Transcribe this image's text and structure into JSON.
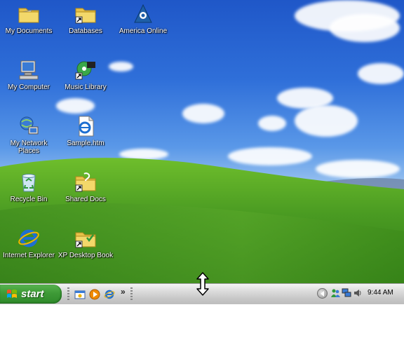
{
  "desktop": {
    "icons": [
      {
        "label": "My Documents"
      },
      {
        "label": "Databases"
      },
      {
        "label": "America Online"
      },
      {
        "label": "My Computer"
      },
      {
        "label": "Music Library"
      },
      {
        "label": "My Network Places"
      },
      {
        "label": "Sample.htm"
      },
      {
        "label": "Recycle Bin"
      },
      {
        "label": "Shared Docs"
      },
      {
        "label": "Internet Explorer"
      },
      {
        "label": "XP Desktop Book"
      }
    ]
  },
  "taskbar": {
    "start_label": "start",
    "quick_launch": {
      "icons": [
        "windows-explorer-icon",
        "media-player-icon",
        "internet-explorer-icon"
      ],
      "more_label": "»"
    },
    "tray": {
      "icons": [
        "messenger-icon",
        "network-icon",
        "volume-icon"
      ],
      "clock": "9:44 AM"
    }
  },
  "colors": {
    "start_green": "#3e9a37",
    "sky_blue": "#2f6fd9",
    "hill_green": "#4a9b22"
  }
}
